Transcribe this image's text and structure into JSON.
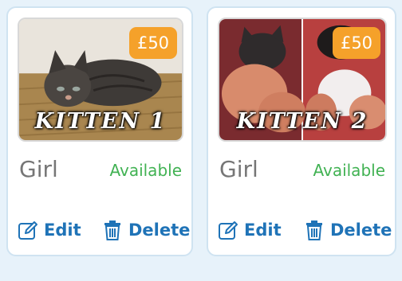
{
  "colors": {
    "background": "#e7f2fa",
    "card": "#ffffff",
    "price_badge": "#f5a12a",
    "available": "#41b253",
    "action": "#1f73b7",
    "gender": "#767676"
  },
  "listings": [
    {
      "price": "£50",
      "caption": "KITTEN 1",
      "gender": "Girl",
      "status": "Available",
      "edit_label": "Edit",
      "delete_label": "Delete",
      "edit_icon": "pencil-edit-icon",
      "delete_icon": "trash-icon"
    },
    {
      "price": "£50",
      "caption": "KITTEN 2",
      "gender": "Girl",
      "status": "Available",
      "edit_label": "Edit",
      "delete_label": "Delete",
      "edit_icon": "pencil-edit-icon",
      "delete_icon": "trash-icon"
    }
  ]
}
